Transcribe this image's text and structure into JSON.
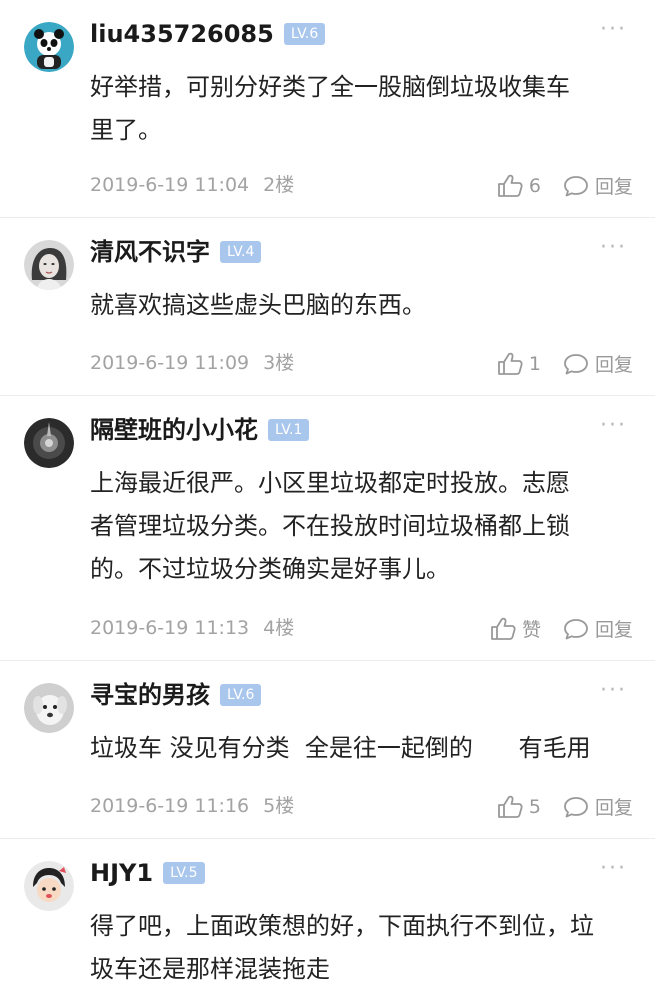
{
  "comments": [
    {
      "username": "liu435726085",
      "level": "LV.6",
      "text": "好举措，可别分好类了全一股脑倒垃圾收集车\n里了。",
      "time": "2019-6-19 11:04",
      "floor": "2楼",
      "likes": "6",
      "reply": "回复",
      "more": "···",
      "avatar": "panda-avatar"
    },
    {
      "username": "清风不识字",
      "level": "LV.4",
      "text": "就喜欢搞这些虚头巴脑的东西。",
      "time": "2019-6-19 11:09",
      "floor": "3楼",
      "likes": "1",
      "reply": "回复",
      "more": "···",
      "avatar": "girl-portrait-avatar"
    },
    {
      "username": "隔壁班的小小花",
      "level": "LV.1",
      "text": "上海最近很严。小区里垃圾都定时投放。志愿\n者管理垃圾分类。不在投放时间垃圾桶都上锁\n的。不过垃圾分类确实是好事儿。",
      "time": "2019-6-19 11:13",
      "floor": "4楼",
      "likes": "赞",
      "reply": "回复",
      "more": "···",
      "avatar": "dark-photo-avatar"
    },
    {
      "username": "寻宝的男孩",
      "level": "LV.6",
      "text": "垃圾车 没见有分类  全是往一起倒的      有毛用",
      "time": "2019-6-19 11:16",
      "floor": "5楼",
      "likes": "5",
      "reply": "回复",
      "more": "···",
      "avatar": "dog-avatar"
    },
    {
      "username": "HJY1",
      "level": "LV.5",
      "text": "得了吧，上面政策想的好，下面执行不到位，垃\n圾车还是那样混装拖走",
      "time": "",
      "floor": "",
      "likes": "",
      "reply": "",
      "more": "···",
      "avatar": "cartoon-girl-avatar"
    }
  ],
  "colors": {
    "level_badge": "#a9c6ec",
    "meta_text": "#a3a3a3",
    "divider": "#ececec"
  }
}
